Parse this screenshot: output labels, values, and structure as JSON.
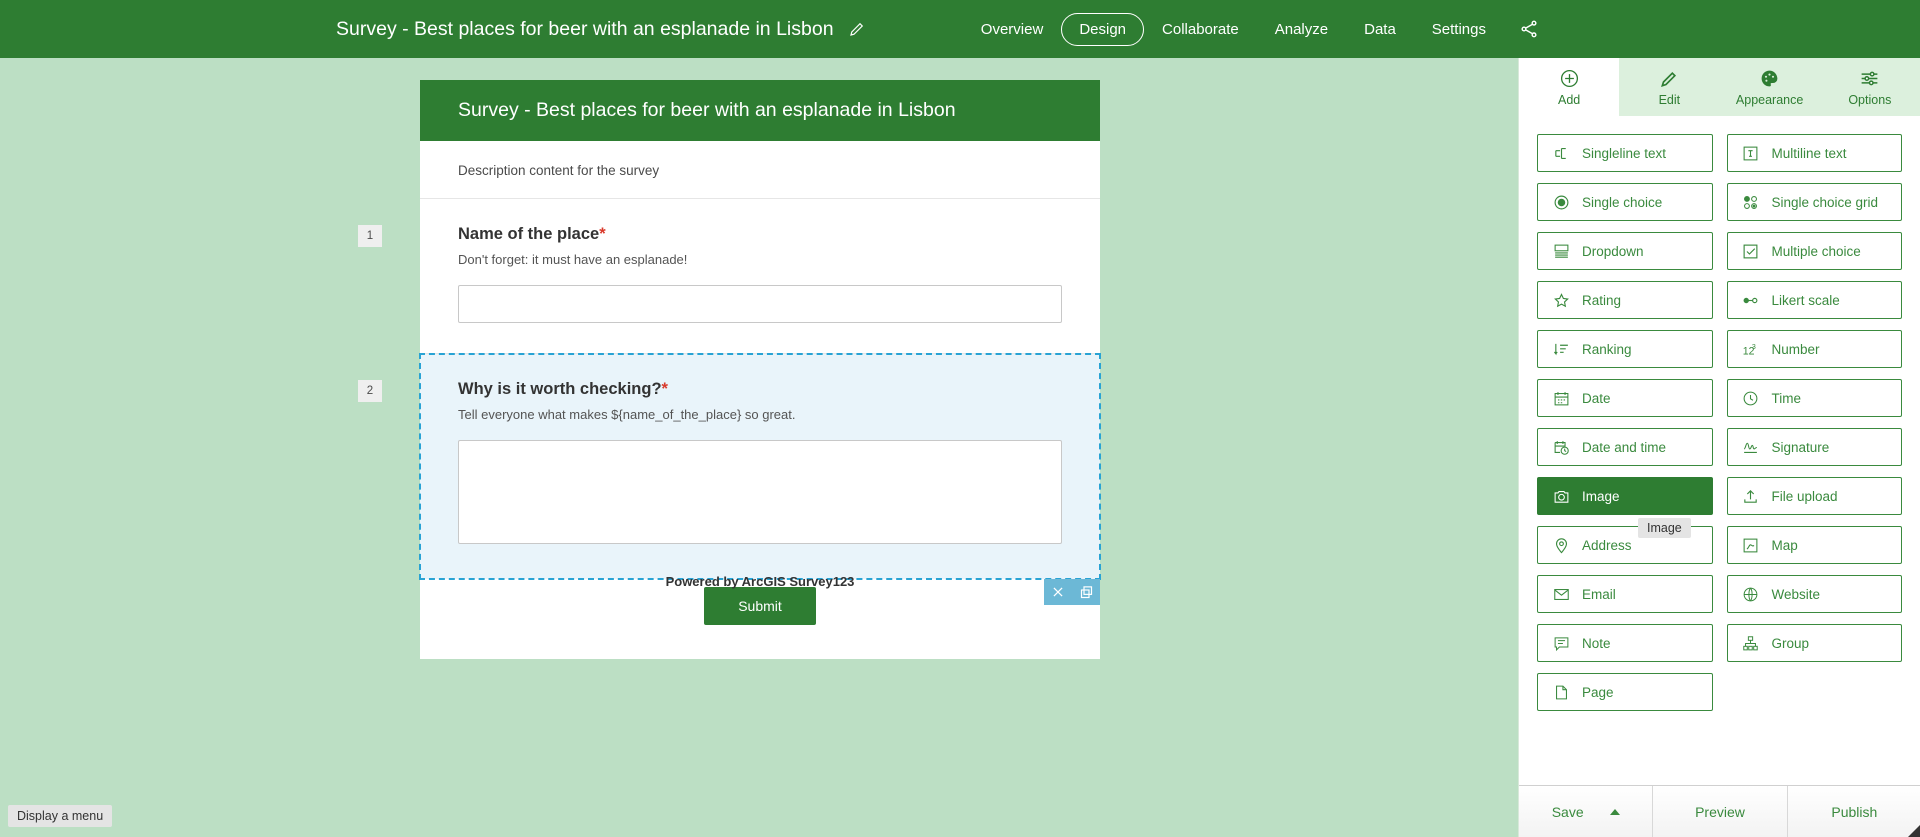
{
  "appbar": {
    "title": "Survey - Best places for beer with an esplanade in Lisbon",
    "edit_icon": "pencil-icon",
    "nav": [
      {
        "label": "Overview",
        "active": false
      },
      {
        "label": "Design",
        "active": true
      },
      {
        "label": "Collaborate",
        "active": false
      },
      {
        "label": "Analyze",
        "active": false
      },
      {
        "label": "Data",
        "active": false
      },
      {
        "label": "Settings",
        "active": false
      }
    ],
    "share_icon": "share-icon",
    "background_color": "#2e7d32"
  },
  "canvas": {
    "background_color": "#bcdfc4",
    "status_bubble": "Display a menu",
    "form": {
      "header_title": "Survey - Best places for beer with an esplanade in Lisbon",
      "description": "Description content for the survey",
      "questions": [
        {
          "number": "1",
          "label": "Name of the place",
          "required_marker": "*",
          "hint": "Don't forget: it must have an esplanade!",
          "input_value": "",
          "input_placeholder": "",
          "selected": false
        },
        {
          "number": "2",
          "label": "Why is it worth checking?",
          "required_marker": "*",
          "hint": "Tell everyone what makes ${name_of_the_place} so great.",
          "input_value": "",
          "input_placeholder": "",
          "selected": true,
          "actions": [
            {
              "name": "delete-question",
              "icon": "close-icon"
            },
            {
              "name": "duplicate-question",
              "icon": "copy-icon"
            }
          ]
        }
      ],
      "submit_label": "Submit",
      "powered_by": "Powered by ArcGIS Survey123"
    }
  },
  "right_panel": {
    "tabs": [
      {
        "label": "Add",
        "icon": "plus-circle-icon",
        "active": true
      },
      {
        "label": "Edit",
        "icon": "pencil-icon",
        "active": false
      },
      {
        "label": "Appearance",
        "icon": "palette-icon",
        "active": false
      },
      {
        "label": "Options",
        "icon": "sliders-icon",
        "active": false
      }
    ],
    "question_types": [
      {
        "label": "Singleline text",
        "icon": "singleline-text-icon",
        "selected": false
      },
      {
        "label": "Multiline text",
        "icon": "multiline-text-icon",
        "selected": false
      },
      {
        "label": "Single choice",
        "icon": "radio-filled-icon",
        "selected": false
      },
      {
        "label": "Single choice grid",
        "icon": "radio-grid-icon",
        "selected": false
      },
      {
        "label": "Dropdown",
        "icon": "dropdown-icon",
        "selected": false
      },
      {
        "label": "Multiple choice",
        "icon": "checkbox-icon",
        "selected": false
      },
      {
        "label": "Rating",
        "icon": "star-icon",
        "selected": false
      },
      {
        "label": "Likert scale",
        "icon": "likert-icon",
        "selected": false
      },
      {
        "label": "Ranking",
        "icon": "ranking-icon",
        "selected": false
      },
      {
        "label": "Number",
        "icon": "number-icon",
        "selected": false
      },
      {
        "label": "Date",
        "icon": "calendar-icon",
        "selected": false
      },
      {
        "label": "Time",
        "icon": "clock-icon",
        "selected": false
      },
      {
        "label": "Date and time",
        "icon": "calendar-clock-icon",
        "selected": false
      },
      {
        "label": "Signature",
        "icon": "signature-icon",
        "selected": false
      },
      {
        "label": "Image",
        "icon": "image-icon",
        "selected": true
      },
      {
        "label": "File upload",
        "icon": "upload-icon",
        "selected": false
      },
      {
        "label": "Address",
        "icon": "pin-icon",
        "selected": false
      },
      {
        "label": "Map",
        "icon": "map-icon",
        "selected": false
      },
      {
        "label": "Email",
        "icon": "envelope-icon",
        "selected": false
      },
      {
        "label": "Website",
        "icon": "globe-icon",
        "selected": false
      },
      {
        "label": "Note",
        "icon": "note-icon",
        "selected": false
      },
      {
        "label": "Group",
        "icon": "group-icon",
        "selected": false
      },
      {
        "label": "Page",
        "icon": "page-icon",
        "selected": false
      }
    ],
    "tooltip": "Image",
    "bottom_bar": [
      {
        "label": "Save",
        "has_caret": true
      },
      {
        "label": "Preview",
        "has_caret": false
      },
      {
        "label": "Publish",
        "has_caret": false
      }
    ]
  },
  "colors": {
    "brand_green": "#2e7d32",
    "panel_green": "#3a8a3e",
    "canvas_green": "#bcdfc4",
    "tab_inactive": "#dcf0dd",
    "selection_blue": "#29a3d4",
    "selection_fill": "#e9f4fa",
    "required_red": "#d9392b"
  }
}
